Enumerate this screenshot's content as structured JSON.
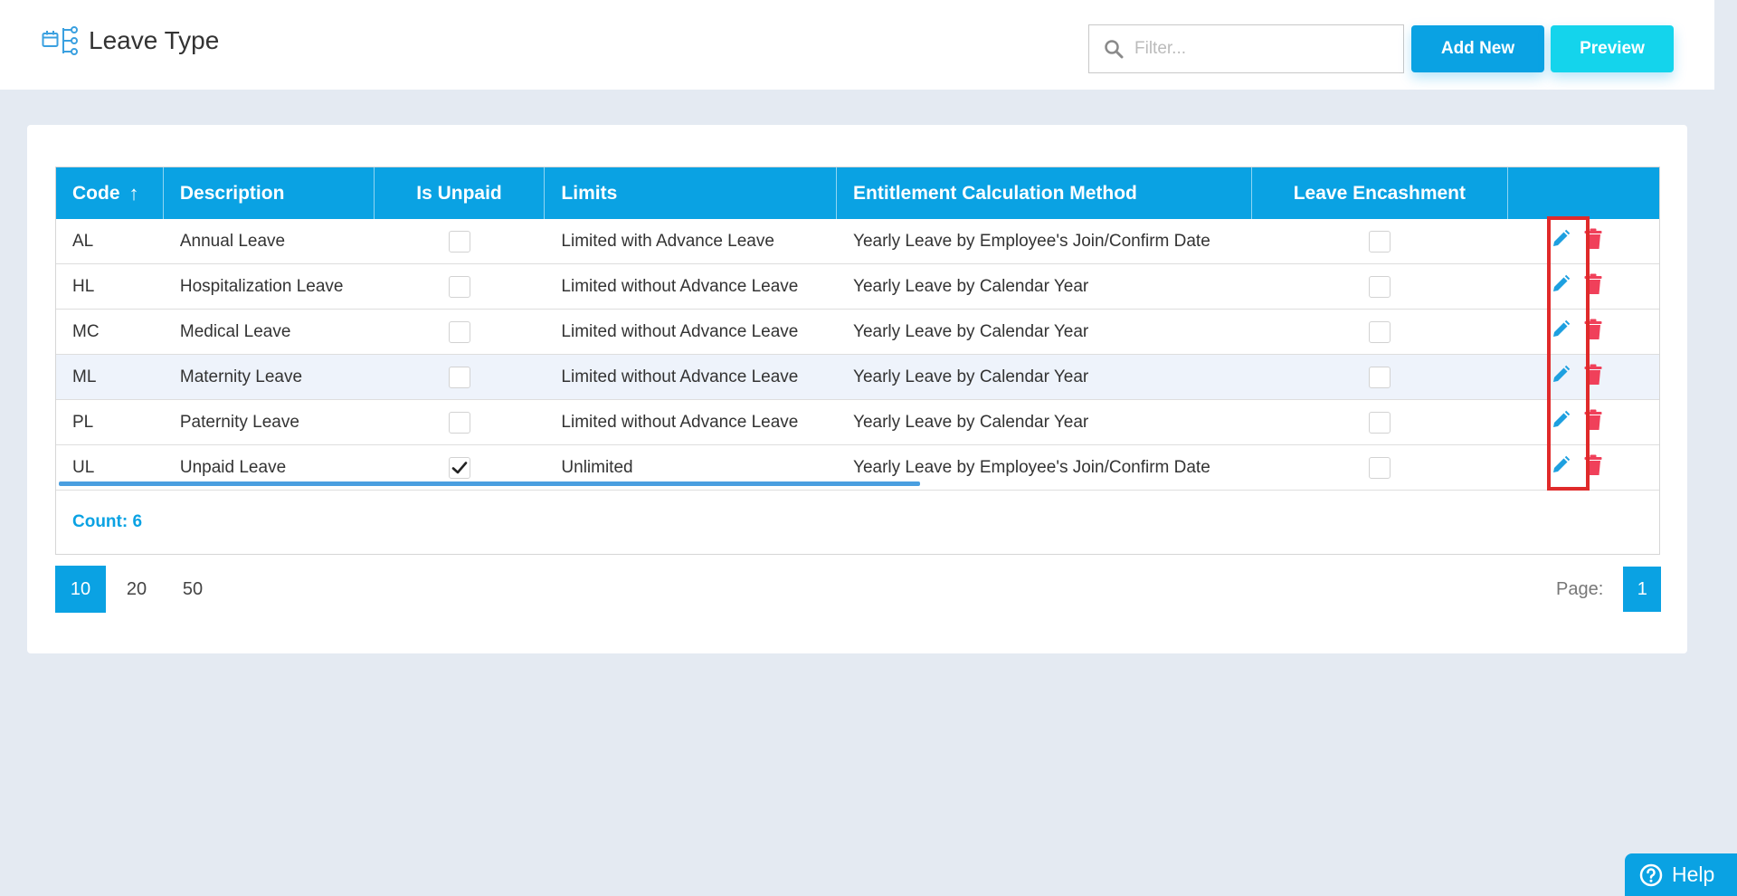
{
  "header": {
    "title": "Leave Type",
    "filter_placeholder": "Filter...",
    "add_new_label": "Add New",
    "preview_label": "Preview"
  },
  "table": {
    "columns": {
      "code": "Code",
      "description": "Description",
      "is_unpaid": "Is Unpaid",
      "limits": "Limits",
      "method": "Entitlement Calculation Method",
      "encashment": "Leave Encashment"
    },
    "sort_indicator": "↑",
    "rows": [
      {
        "code": "AL",
        "description": "Annual Leave",
        "is_unpaid": false,
        "limits": "Limited with Advance Leave",
        "method": "Yearly Leave by Employee's Join/Confirm Date",
        "encashment": false
      },
      {
        "code": "HL",
        "description": "Hospitalization Leave",
        "is_unpaid": false,
        "limits": "Limited without Advance Leave",
        "method": "Yearly Leave by Calendar Year",
        "encashment": false
      },
      {
        "code": "MC",
        "description": "Medical Leave",
        "is_unpaid": false,
        "limits": "Limited without Advance Leave",
        "method": "Yearly Leave by Calendar Year",
        "encashment": false
      },
      {
        "code": "ML",
        "description": "Maternity Leave",
        "is_unpaid": false,
        "limits": "Limited without Advance Leave",
        "method": "Yearly Leave by Calendar Year",
        "encashment": false
      },
      {
        "code": "PL",
        "description": "Paternity Leave",
        "is_unpaid": false,
        "limits": "Limited without Advance Leave",
        "method": "Yearly Leave by Calendar Year",
        "encashment": false
      },
      {
        "code": "UL",
        "description": "Unpaid Leave",
        "is_unpaid": true,
        "limits": "Unlimited",
        "method": "Yearly Leave by Employee's Join/Confirm Date",
        "encashment": false
      }
    ],
    "count_label": "Count: 6"
  },
  "pager": {
    "sizes": [
      "10",
      "20",
      "50"
    ],
    "active_size": "10",
    "page_label": "Page:",
    "current_page": "1"
  },
  "help_label": "Help",
  "colors": {
    "primary": "#0aa2e3",
    "preview": "#14d4ec",
    "delete": "#f0405a",
    "edit": "#1ea0e0",
    "highlight": "#e02a2a"
  },
  "icons": {
    "title": "leave-type-icon",
    "filter": "search-icon",
    "edit": "pencil-icon",
    "delete": "trash-icon",
    "help": "question-circle-icon"
  }
}
